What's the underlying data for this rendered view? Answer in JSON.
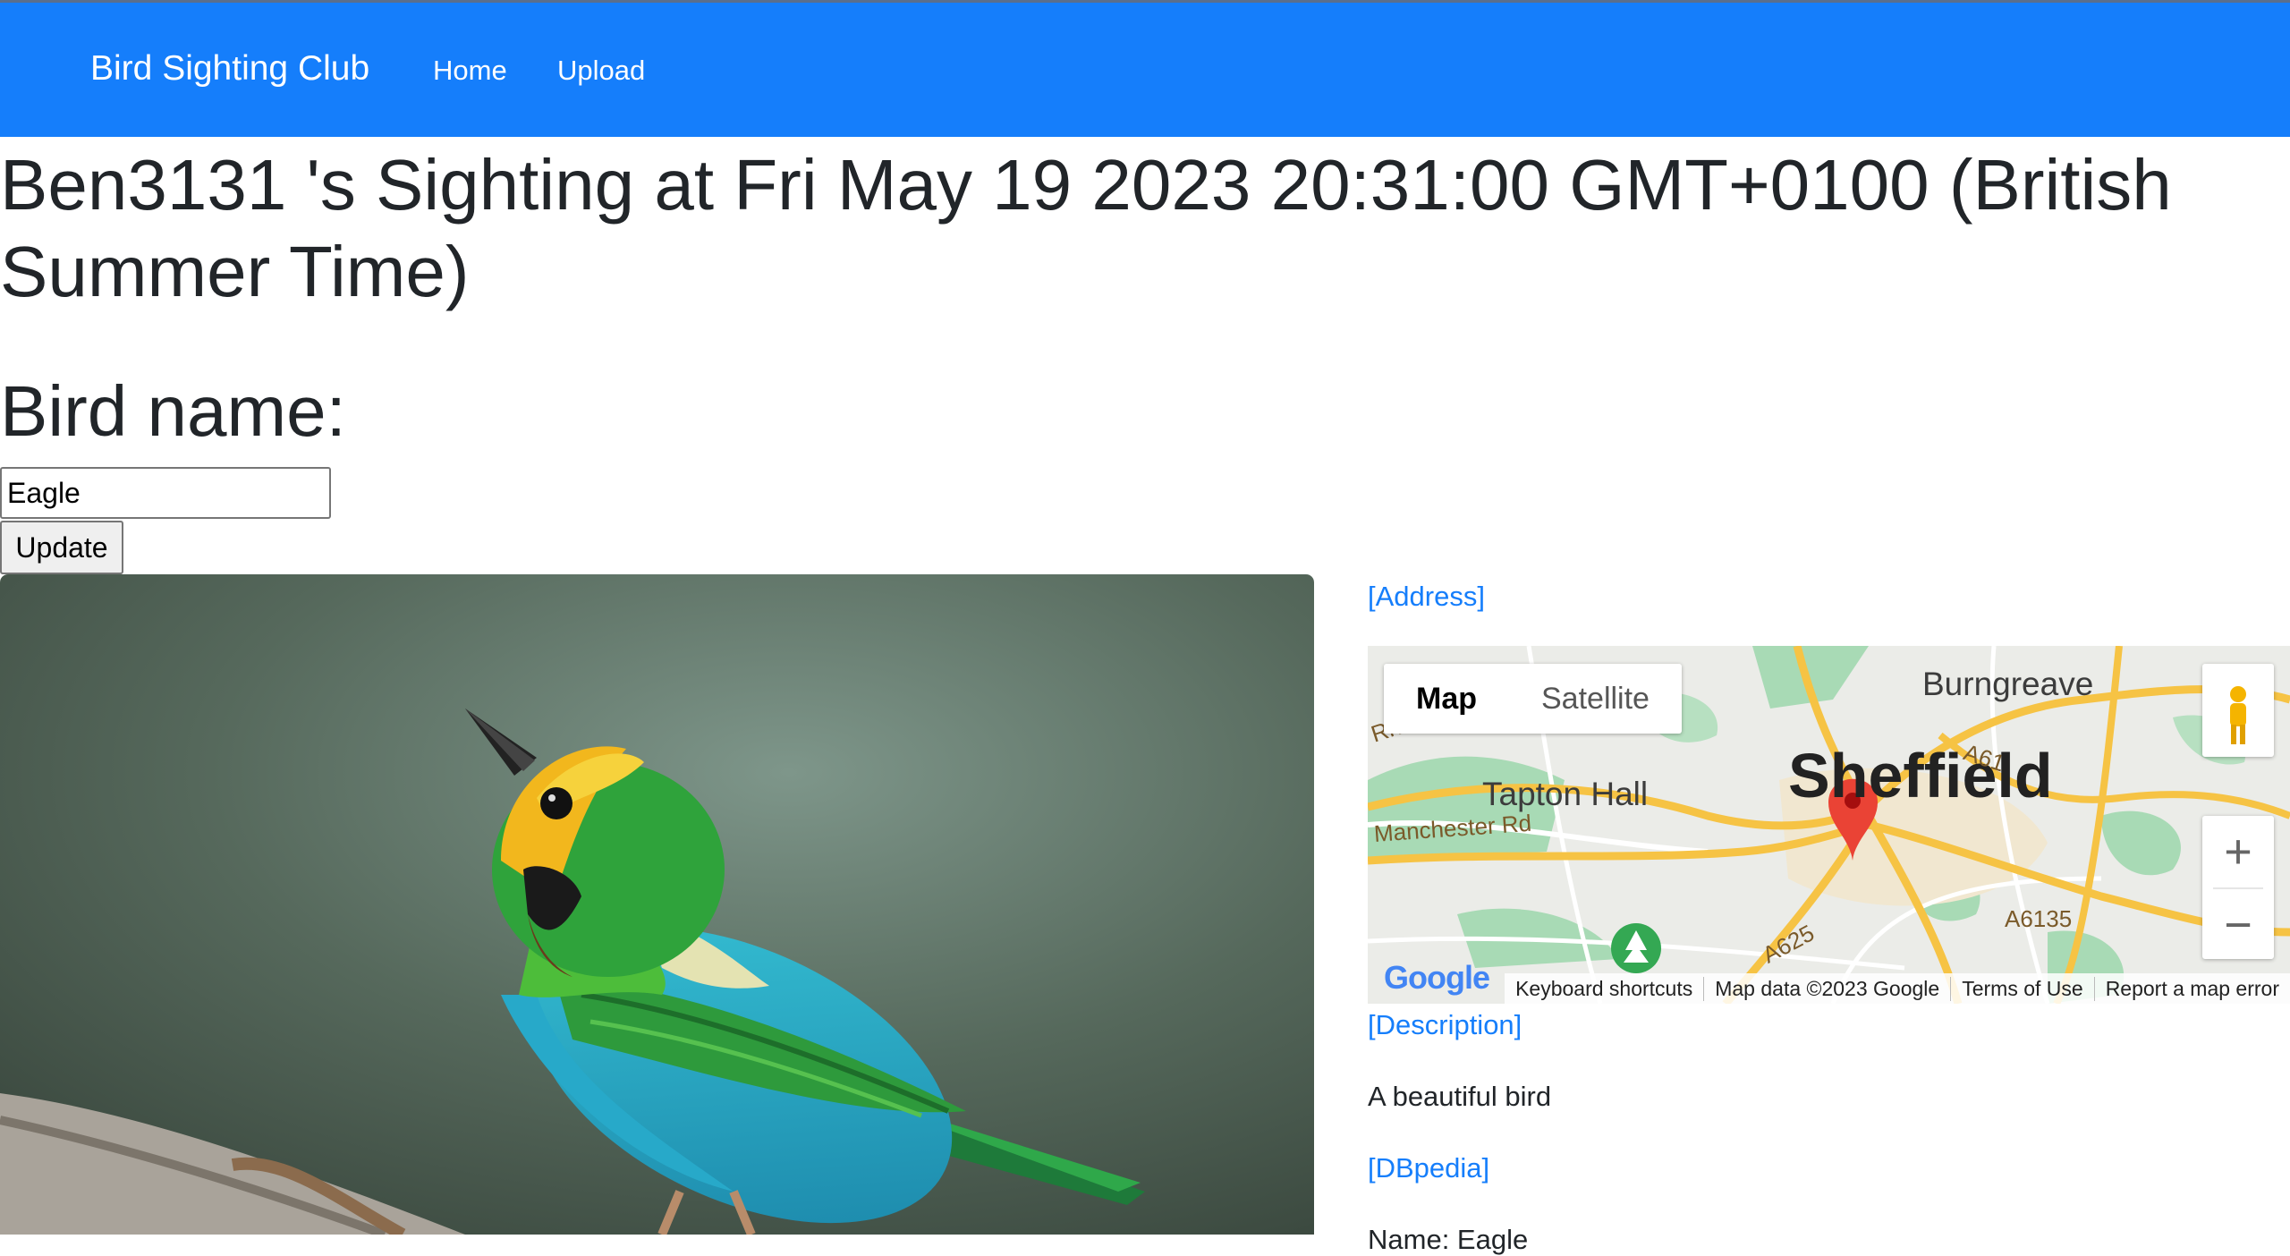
{
  "navbar": {
    "brand": "Bird Sighting Club",
    "links": [
      "Home",
      "Upload"
    ],
    "background": "#157efb"
  },
  "sighting": {
    "title": "Ben3131 's Sighting at Fri May 19 2023 20:31:00 GMT+0100 (British Summer Time)",
    "bird_name_label": "Bird name:",
    "bird_name_value": "Eagle",
    "update_label": "Update"
  },
  "photo": {
    "subject": "multicolored tanager bird on branch"
  },
  "details": {
    "address_link": "[Address]",
    "description_link": "[Description]",
    "description_text": "A beautiful bird",
    "dbpedia_link": "[DBpedia]",
    "name_line": "Name: Eagle"
  },
  "map": {
    "type_map": "Map",
    "type_satellite": "Satellite",
    "zoom_in": "+",
    "zoom_out": "−",
    "logo": "Google",
    "footer": [
      "Keyboard shortcuts",
      "Map data ©2023 Google",
      "Terms of Use",
      "Report a map error"
    ],
    "places": {
      "city": "Sheffield",
      "burngreave": "Burngreave",
      "tapton": "Tapton Hall",
      "rivelin": "Rivelin Valley Rd",
      "manchester": "Manchester Rd",
      "a61": "A61",
      "a6135": "A6135",
      "a625": "A625"
    },
    "colors": {
      "road": "#f6c344",
      "park": "#a8dab5",
      "marker": "#ea4335"
    }
  }
}
